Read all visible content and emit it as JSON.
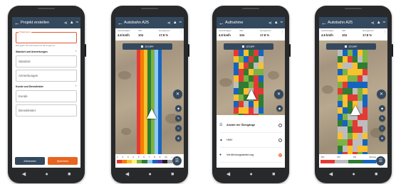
{
  "phones": [
    {
      "title": "Projekt erstellen",
      "project_field_label": "Projektname",
      "hint": "Bitte geben Sie einen Namen für das Projekt an.",
      "section1": "Standort und Anmerkungen",
      "standort": "Standort",
      "anmerkungen": "Anmerkungen",
      "section2": "Kunde und Dienstleister",
      "kunde": "Kunde",
      "dienstleister": "Dienstleister",
      "cancel": "Abbrechen",
      "save": "Speichern"
    },
    {
      "title": "Autobahn A25",
      "stats": [
        {
          "label": "Geschwindigkeit",
          "value": "4.8 km/h"
        },
        {
          "label": "HMV",
          "value": "104"
        },
        {
          "label": "Sprungbereich",
          "value": "17.8 %"
        }
      ],
      "stop": "STOPP",
      "legend_numbers": [
        "1",
        "2",
        "3",
        "4",
        "5",
        "6",
        "7",
        "8",
        "9",
        "10",
        "+"
      ],
      "legend_colors": [
        "#e53935",
        "#f57c00",
        "#fbc02d",
        "#fff176",
        "#7cb342",
        "#2e7d32",
        "#90caf9",
        "#1565c0",
        "#5e35b1",
        "#212121",
        "#9e9e9e"
      ],
      "lane_colors": [
        "#e53935",
        "#f57c00",
        "#fbc02d",
        "#2e7d32",
        "#7cb342",
        "#90caf9",
        "#1565c0"
      ]
    },
    {
      "title": "Aufnahme",
      "stats": [
        {
          "label": "Geschwindigkeit",
          "value": "4.8 km/h"
        },
        {
          "label": "HMV",
          "value": "104"
        },
        {
          "label": "Sprungbereich",
          "value": "17.8 %"
        }
      ],
      "stop": "STOPP",
      "options": [
        {
          "label": "Anzahl der Übergänge",
          "bold": true,
          "icon": "layers-icon",
          "selected": false
        },
        {
          "label": "HMV",
          "bold": false,
          "icon": "roller-icon",
          "selected": false
        },
        {
          "label": "Verdichtungsänderung",
          "bold": false,
          "icon": "compaction-icon",
          "selected": true
        }
      ]
    },
    {
      "title": "Autobahn A25",
      "stats": [
        {
          "label": "Geschwindigkeit",
          "value": "4.8 km/h"
        },
        {
          "label": "HMV",
          "value": "104"
        },
        {
          "label": "Sprungbereich",
          "value": "17.8 %"
        }
      ],
      "stop": "STOPP",
      "legend_labels": [
        "-5%",
        "0%",
        "5%",
        "Sprung"
      ],
      "legend_colors": [
        "#e53935",
        "#bdbdbd",
        "#2e7d32",
        "#1565c0"
      ]
    }
  ],
  "grid_palette": [
    "#fbc02d",
    "#2e7d32",
    "#e53935",
    "#1565c0",
    "#bdbdbd",
    "#7cb342"
  ]
}
